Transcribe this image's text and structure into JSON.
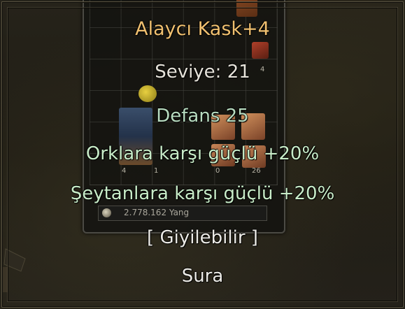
{
  "tooltip": {
    "title": "Alaycı Kask+4",
    "level": "Seviye: 21",
    "defense": "Defans 25",
    "bonus_1": "Orklara karşı güçlü +20%",
    "bonus_2": "Şeytanlara karşı güçlü +20%",
    "wearable": "[ Giyilebilir ]",
    "class_name": "Sura",
    "title_color": "#f0c070",
    "bonus_color": "#c8ecc8"
  },
  "inventory": {
    "slot_counts": [
      "4",
      "1",
      "0",
      "26"
    ],
    "extra_count": "4",
    "gold": "2.778.162 Yang",
    "gold_icon": "coin-icon"
  }
}
